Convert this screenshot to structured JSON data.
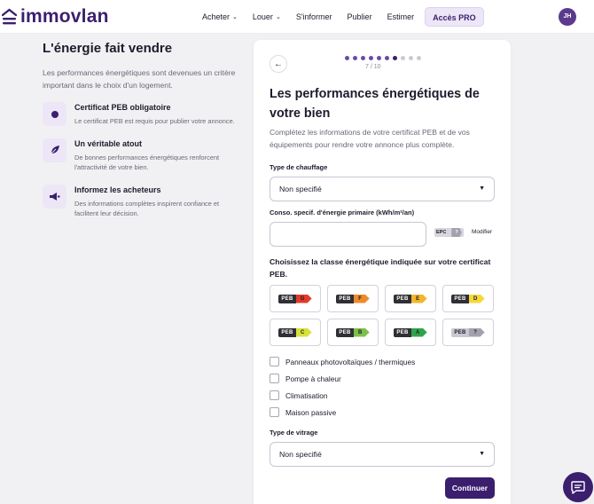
{
  "header": {
    "logo_text": "immovlan",
    "nav": [
      {
        "label": "Acheter",
        "has_chevron": true
      },
      {
        "label": "Louer",
        "has_chevron": true
      },
      {
        "label": "S'informer",
        "has_chevron": false
      },
      {
        "label": "Publier",
        "has_chevron": false
      },
      {
        "label": "Estimer",
        "has_chevron": false
      }
    ],
    "pro_label": "Accès PRO",
    "avatar_initials": "JH"
  },
  "info": {
    "title": "L'énergie fait vendre",
    "intro": "Les performances énergétiques sont devenues un critère important dans le choix d'un logement.",
    "features": [
      {
        "icon": "certificate-dot-icon",
        "title": "Certificat PEB obligatoire",
        "text": "Le certificat PEB est requis pour publier votre annonce."
      },
      {
        "icon": "leaf-icon",
        "title": "Un véritable atout",
        "text": "De bonnes performances énergétiques renforcent l'attractivité de votre bien."
      },
      {
        "icon": "megaphone-icon",
        "title": "Informez les acheteurs",
        "text": "Des informations complètes inspirent confiance et facilitent leur décision."
      }
    ]
  },
  "form": {
    "progress": {
      "current": 7,
      "total": 10,
      "label": "7 / 10"
    },
    "title": "Les performances énergétiques de votre bien",
    "intro": "Complétez les informations de votre certificat PEB et de vos équipements pour rendre votre annonce plus complète.",
    "heating": {
      "label": "Type de chauffage",
      "value": "Non specifié"
    },
    "consumption": {
      "label": "Conso. specif. d'énergie primaire (kWh/m²/an)",
      "value": "",
      "epc_label": "EPC",
      "epc_value": "?",
      "modify_label": "Modifier"
    },
    "energy_class": {
      "question": "Choisissez la classe énergétique indiquée sur votre certificat PEB.",
      "peb_word": "PEB",
      "options": [
        {
          "letter": "G",
          "color": "#e03b2a"
        },
        {
          "letter": "F",
          "color": "#ef8a2b"
        },
        {
          "letter": "E",
          "color": "#f2b72a"
        },
        {
          "letter": "D",
          "color": "#f5d73a"
        },
        {
          "letter": "C",
          "color": "#d6e23a"
        },
        {
          "letter": "B",
          "color": "#7cc04a"
        },
        {
          "letter": "A",
          "color": "#2fa44a"
        },
        {
          "letter": "?",
          "color": "#a3a1ad"
        }
      ]
    },
    "equipment": [
      {
        "label": "Panneaux photovoltaïques / thermiques",
        "checked": false
      },
      {
        "label": "Pompe à chaleur",
        "checked": false
      },
      {
        "label": "Climatisation",
        "checked": false
      },
      {
        "label": "Maison passive",
        "checked": false
      }
    ],
    "glazing": {
      "label": "Type de vitrage",
      "value": "Non specifié"
    },
    "submit_label": "Continuer"
  },
  "colors": {
    "brand": "#3b1f6e",
    "brand_light": "#ece6f7"
  }
}
